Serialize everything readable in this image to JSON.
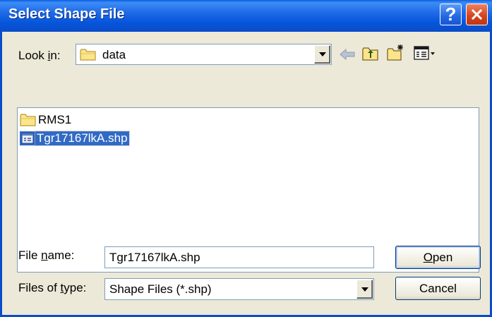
{
  "window": {
    "title": "Select Shape File",
    "help_glyph": "?"
  },
  "lookin": {
    "label_prefix": "Look ",
    "label_mnemonic": "i",
    "label_suffix": "n:",
    "value": "data",
    "icon": "folder-icon"
  },
  "toolbar": {
    "icons": [
      "back-arrow-icon",
      "up-folder-icon",
      "new-folder-icon",
      "view-menu-icon"
    ]
  },
  "files": [
    {
      "name": "RMS1",
      "type": "folder",
      "selected": false
    },
    {
      "name": "Tgr17167lkA.shp",
      "type": "shape-file",
      "selected": true
    }
  ],
  "filename": {
    "label_prefix": "File ",
    "label_mnemonic": "n",
    "label_suffix": "ame:",
    "value": "Tgr17167lkA.shp"
  },
  "filetype": {
    "label_prefix": "Files of ",
    "label_mnemonic": "t",
    "label_suffix": "ype:",
    "value": "Shape Files (*.shp)"
  },
  "buttons": {
    "open_mnemonic": "O",
    "open_rest": "pen",
    "cancel": "Cancel"
  },
  "colors": {
    "title_bar": "#0a5fe4",
    "selection": "#316ac5",
    "dialog_bg": "#ece9d8"
  }
}
